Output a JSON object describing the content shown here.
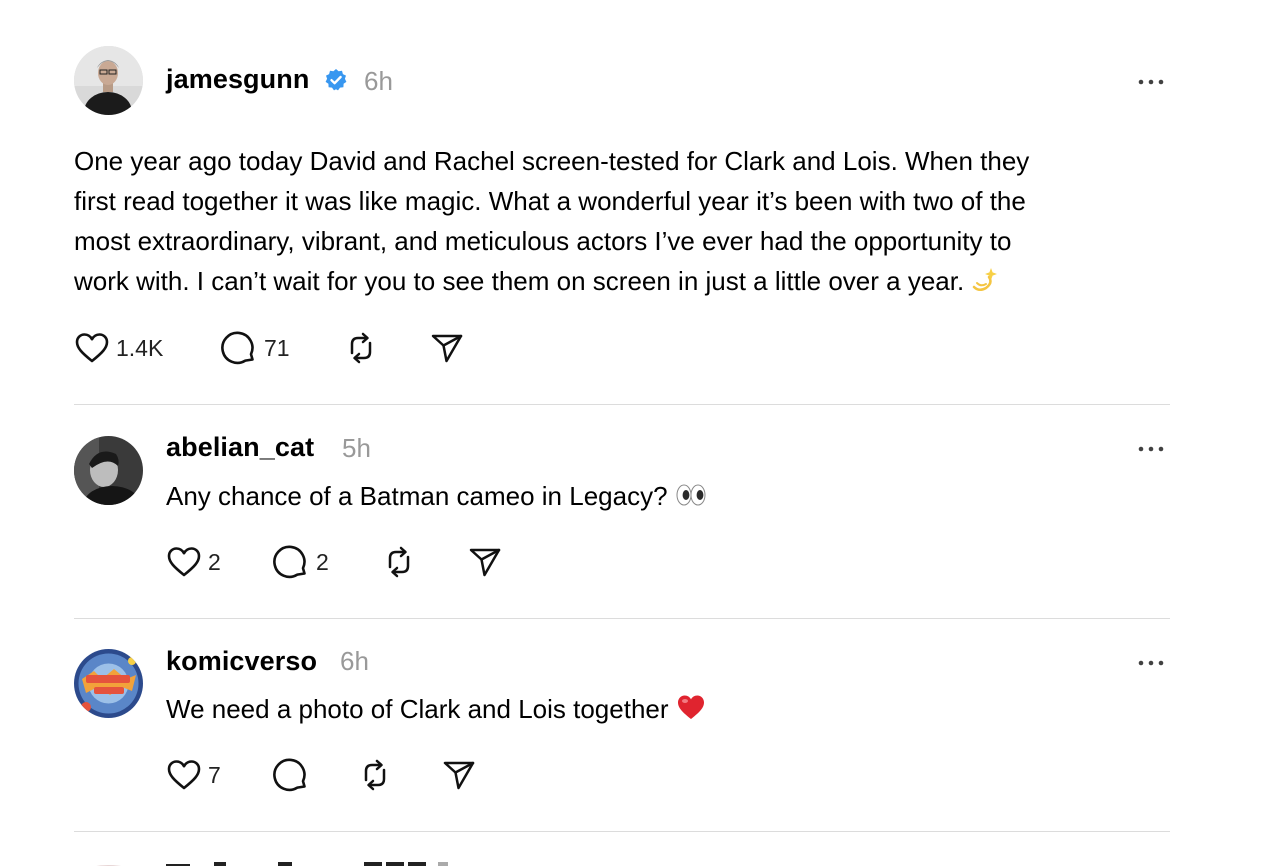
{
  "colors": {
    "verified": "#3897f0",
    "timestamp": "#999999",
    "divider": "#dcdcdc",
    "heart_emoji": "#e0242f"
  },
  "main_post": {
    "username": "jamesgunn",
    "verified": true,
    "time": "6h",
    "text_lines": [
      "One year ago today David and Rachel screen-tested for Clark and Lois. When they",
      "first read together it was like magic. What a wonderful year it’s been with two of the",
      "most extraordinary, vibrant, and meticulous actors I’ve ever had the opportunity to",
      "work with. I can’t wait for you to see them on screen in just a little over a year. "
    ],
    "trailing_emoji": "dizzy-emoji",
    "likes": "1.4K",
    "replies": "71"
  },
  "replies": [
    {
      "username": "abelian_cat",
      "time": "5h",
      "text": "Any chance of a Batman cameo in Legacy? ",
      "trailing_emoji": "eyes-emoji",
      "likes": "2",
      "replies": "2"
    },
    {
      "username": "komicverso",
      "time": "6h",
      "text": "We need a photo of Clark and Lois together ",
      "trailing_emoji": "red-heart-emoji",
      "likes": "7",
      "replies": ""
    }
  ]
}
